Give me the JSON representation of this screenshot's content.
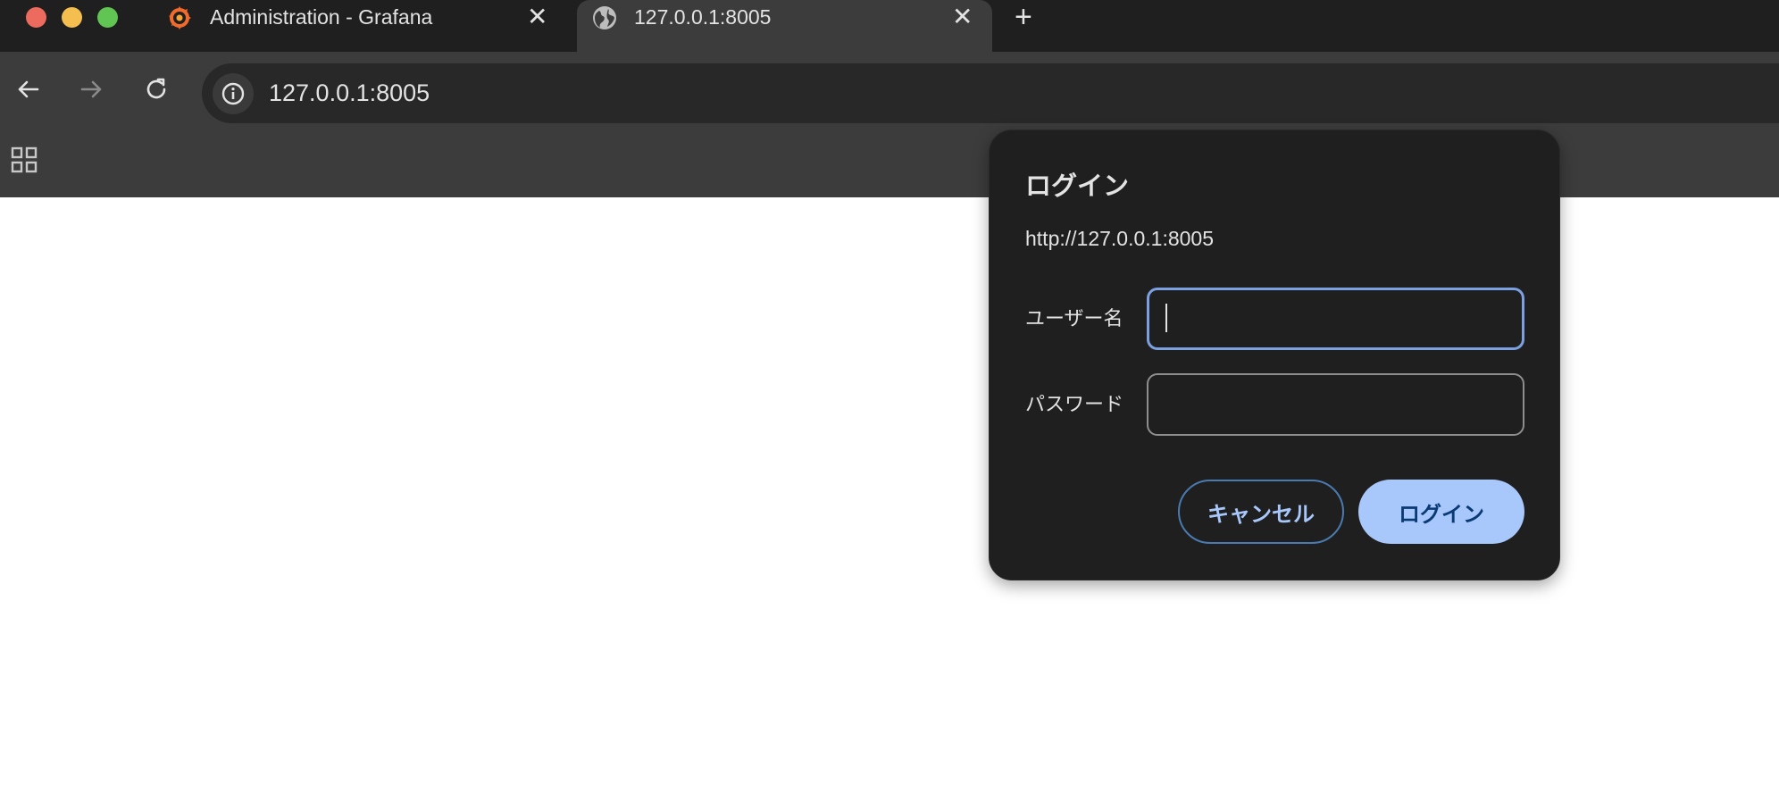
{
  "browser": {
    "tabs": [
      {
        "title": "Administration - Grafana",
        "favicon": "grafana-icon",
        "active": false
      },
      {
        "title": "127.0.0.1:8005",
        "favicon": "globe-icon",
        "active": true
      }
    ],
    "close_glyph": "✕",
    "new_tab_glyph": "+",
    "address": "127.0.0.1:8005"
  },
  "dialog": {
    "title": "ログイン",
    "origin": "http://127.0.0.1:8005",
    "username_label": "ユーザー名",
    "username_value": "",
    "password_label": "パスワード",
    "password_value": "",
    "cancel_label": "キャンセル",
    "login_label": "ログイン"
  },
  "colors": {
    "tabstrip": "#1f1f1f",
    "toolbar": "#3c3c3c",
    "dialog_bg": "#1f1f1f",
    "accent": "#a8c7fa",
    "focus_ring": "#7ca0e0"
  }
}
